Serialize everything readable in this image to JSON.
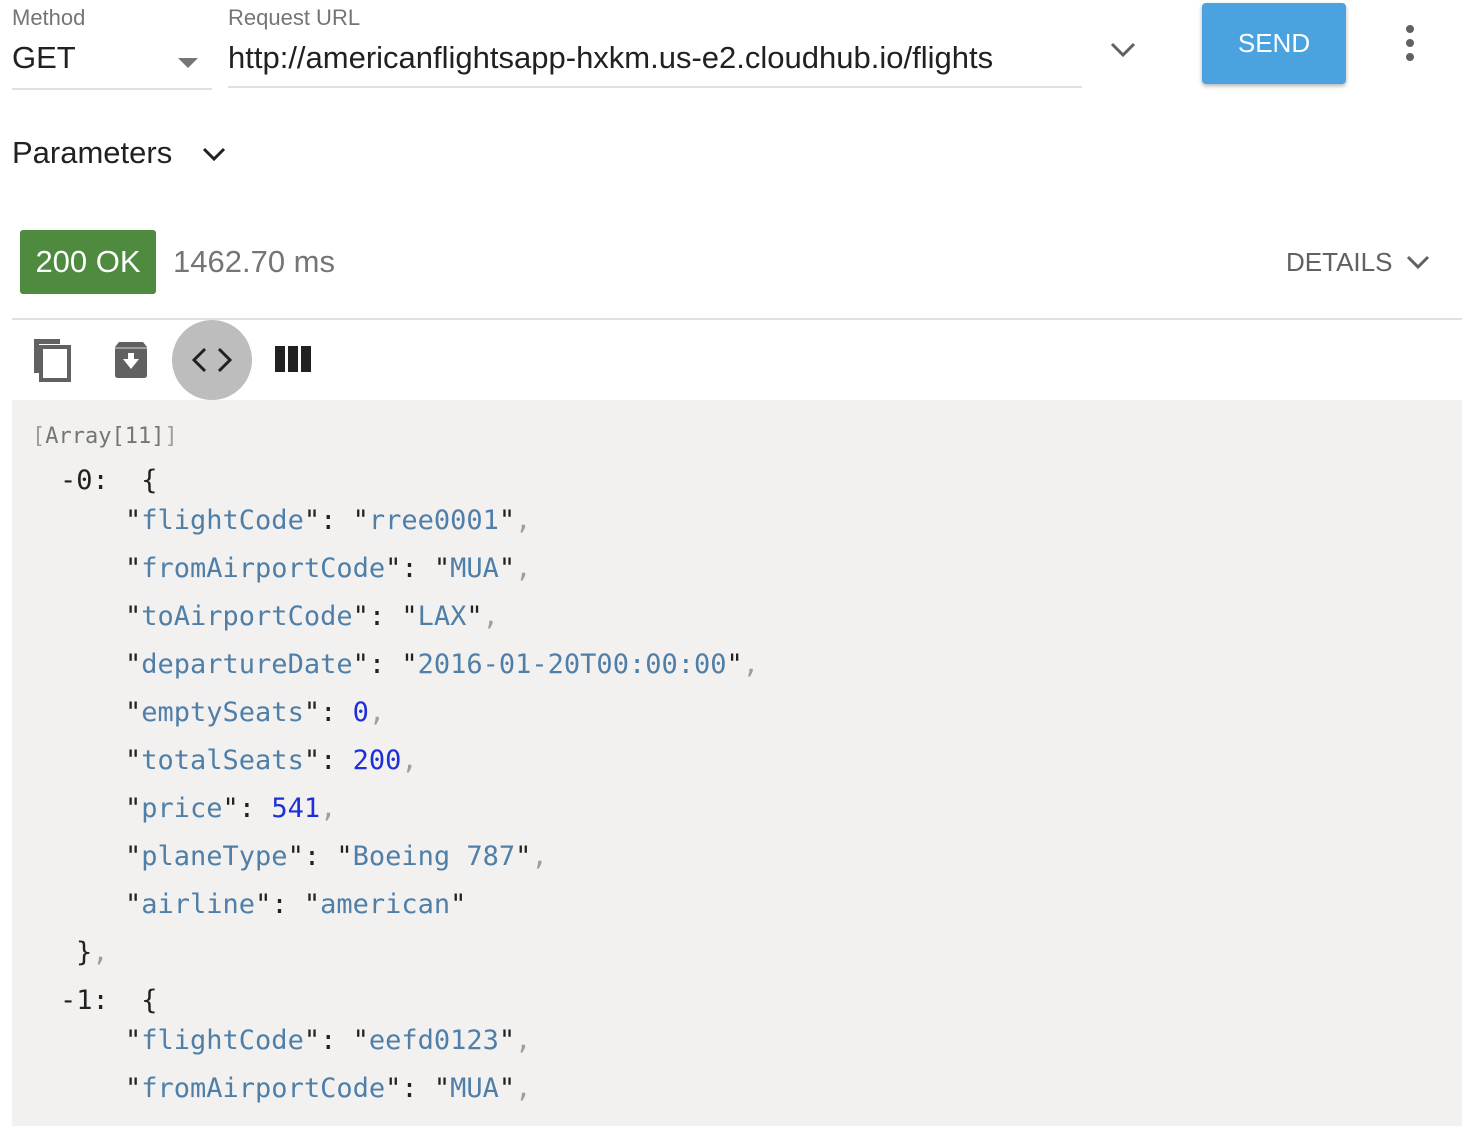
{
  "request": {
    "method_label": "Method",
    "method_value": "GET",
    "url_label": "Request URL",
    "url_value": "http://americanflightsapp-hxkm.us-e2.cloudhub.io/flights",
    "send_label": "SEND"
  },
  "parameters": {
    "label": "Parameters"
  },
  "status": {
    "badge": "200 OK",
    "badge_color": "#4e8b3e",
    "timing": "1462.70 ms",
    "details_label": "DETAILS"
  },
  "toolbar": {
    "icons": [
      "copy-icon",
      "download-icon",
      "code-view-icon",
      "columns-icon"
    ],
    "active": "code-view-icon"
  },
  "response": {
    "array_label": "Array[11]",
    "items": [
      {
        "index": "-0:",
        "fields": [
          {
            "key": "flightCode",
            "value": "rree0001",
            "type": "string"
          },
          {
            "key": "fromAirportCode",
            "value": "MUA",
            "type": "string"
          },
          {
            "key": "toAirportCode",
            "value": "LAX",
            "type": "string"
          },
          {
            "key": "departureDate",
            "value": "2016-01-20T00:00:00",
            "type": "string"
          },
          {
            "key": "emptySeats",
            "value": "0",
            "type": "number"
          },
          {
            "key": "totalSeats",
            "value": "200",
            "type": "number"
          },
          {
            "key": "price",
            "value": "541",
            "type": "number"
          },
          {
            "key": "planeType",
            "value": "Boeing 787",
            "type": "string"
          },
          {
            "key": "airline",
            "value": "american",
            "type": "string"
          }
        ]
      },
      {
        "index": "-1:",
        "fields": [
          {
            "key": "flightCode",
            "value": "eefd0123",
            "type": "string"
          },
          {
            "key": "fromAirportCode",
            "value": "MUA",
            "type": "string"
          }
        ]
      }
    ]
  }
}
